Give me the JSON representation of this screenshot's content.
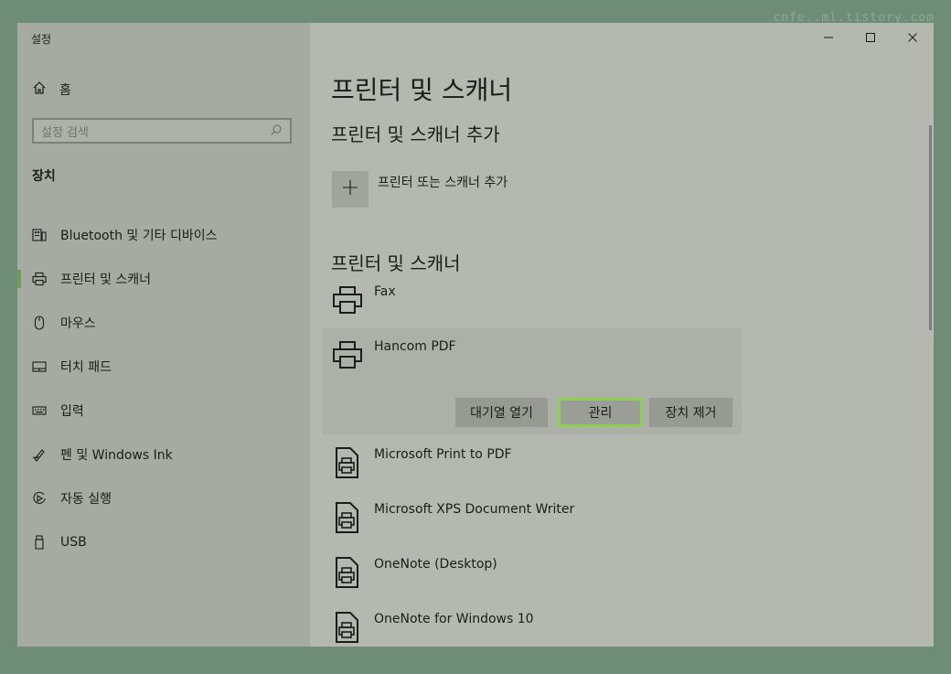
{
  "watermark": "cnfe..ml.tistory.com",
  "window": {
    "title": "설정",
    "controls": {
      "minimize_icon": "minimize-icon",
      "maximize_icon": "maximize-icon",
      "close_icon": "close-icon"
    }
  },
  "sidebar": {
    "home_label": "홈",
    "search_placeholder": "설정 검색",
    "section_title": "장치",
    "items": [
      {
        "label": "Bluetooth 및 기타 디바이스",
        "icon": "bluetooth-devices-icon"
      },
      {
        "label": "프린터 및 스캐너",
        "icon": "printer-icon",
        "active": true
      },
      {
        "label": "마우스",
        "icon": "mouse-icon"
      },
      {
        "label": "터치 패드",
        "icon": "touchpad-icon"
      },
      {
        "label": "입력",
        "icon": "keyboard-icon"
      },
      {
        "label": "펜 및 Windows Ink",
        "icon": "pen-icon"
      },
      {
        "label": "자동 실행",
        "icon": "autoplay-icon"
      },
      {
        "label": "USB",
        "icon": "usb-icon"
      }
    ]
  },
  "main": {
    "title": "프린터 및 스캐너",
    "add_section_title": "프린터 및 스캐너 추가",
    "add_label": "프린터 또는 스캐너 추가",
    "list_title": "프린터 및 스캐너",
    "devices": [
      {
        "name": "Fax",
        "icon": "printer-icon"
      },
      {
        "name": "Hancom PDF",
        "icon": "printer-icon",
        "selected": true
      },
      {
        "name": "Microsoft Print to PDF",
        "icon": "document-printer-icon"
      },
      {
        "name": "Microsoft XPS Document Writer",
        "icon": "document-printer-icon"
      },
      {
        "name": "OneNote (Desktop)",
        "icon": "document-printer-icon"
      },
      {
        "name": "OneNote for Windows 10",
        "icon": "document-printer-icon"
      }
    ],
    "actions": {
      "open_queue": "대기열 열기",
      "manage": "관리",
      "remove": "장치 제거"
    }
  },
  "colors": {
    "focus_outline": "#8fcf51",
    "active_indicator": "#6c9e57",
    "overlay_background": "#6f8c76"
  }
}
